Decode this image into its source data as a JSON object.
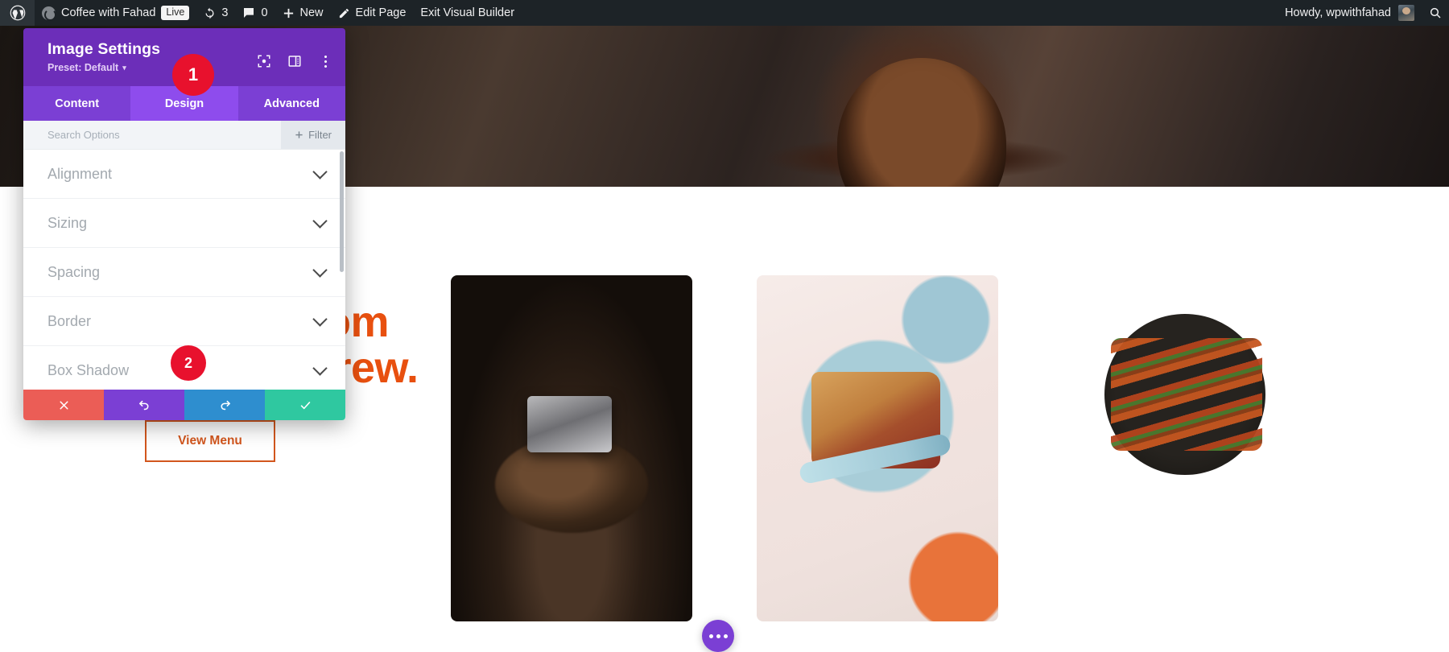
{
  "admin_bar": {
    "logo_icon": "wordpress-logo-icon",
    "site_name": "Coffee with Fahad",
    "live_badge": "Live",
    "updates_icon": "updates-icon",
    "updates_count": "3",
    "comments_icon": "comments-icon",
    "comments_count": "0",
    "new_icon": "plus-icon",
    "new_label": "New",
    "edit_icon": "pencil-icon",
    "edit_label": "Edit Page",
    "exit_label": "Exit Visual Builder",
    "howdy": "Howdy, wpwithfahad",
    "avatar_icon": "user-avatar",
    "search_icon": "search-icon"
  },
  "settings_panel": {
    "title": "Image Settings",
    "preset_label": "Preset: Default",
    "preset_caret": "▾",
    "header_icons": [
      {
        "name": "focus-target-icon"
      },
      {
        "name": "panel-layout-icon"
      },
      {
        "name": "more-options-icon"
      }
    ],
    "tabs": [
      {
        "label": "Content",
        "active": false
      },
      {
        "label": "Design",
        "active": true
      },
      {
        "label": "Advanced",
        "active": false
      }
    ],
    "search": {
      "placeholder": "Search Options",
      "value": ""
    },
    "filter": {
      "icon": "plus-icon",
      "label": "Filter"
    },
    "sections": [
      {
        "label": "Alignment"
      },
      {
        "label": "Sizing"
      },
      {
        "label": "Spacing"
      },
      {
        "label": "Border"
      },
      {
        "label": "Box Shadow"
      }
    ],
    "actions": [
      {
        "name": "cancel",
        "icon": "close-x-icon",
        "color": "#eb5d56"
      },
      {
        "name": "undo",
        "icon": "undo-icon",
        "color": "#7b3fd4"
      },
      {
        "name": "redo",
        "icon": "redo-icon",
        "color": "#2e8ecf"
      },
      {
        "name": "save",
        "icon": "checkmark-icon",
        "color": "#2fc8a0"
      }
    ]
  },
  "callouts": [
    {
      "number": "1"
    },
    {
      "number": "2"
    }
  ],
  "page_content": {
    "heading_line1": "coffee, from",
    "heading_line2": "bean to brew.",
    "heading_color": "#e8500f",
    "cta_label": "View Menu",
    "images": [
      {
        "name": "coffee-grinder-photo"
      },
      {
        "name": "jam-toast-photo"
      },
      {
        "name": "kebab-skillet-photo"
      }
    ],
    "fab_icon": "more-horizontal-icon"
  }
}
